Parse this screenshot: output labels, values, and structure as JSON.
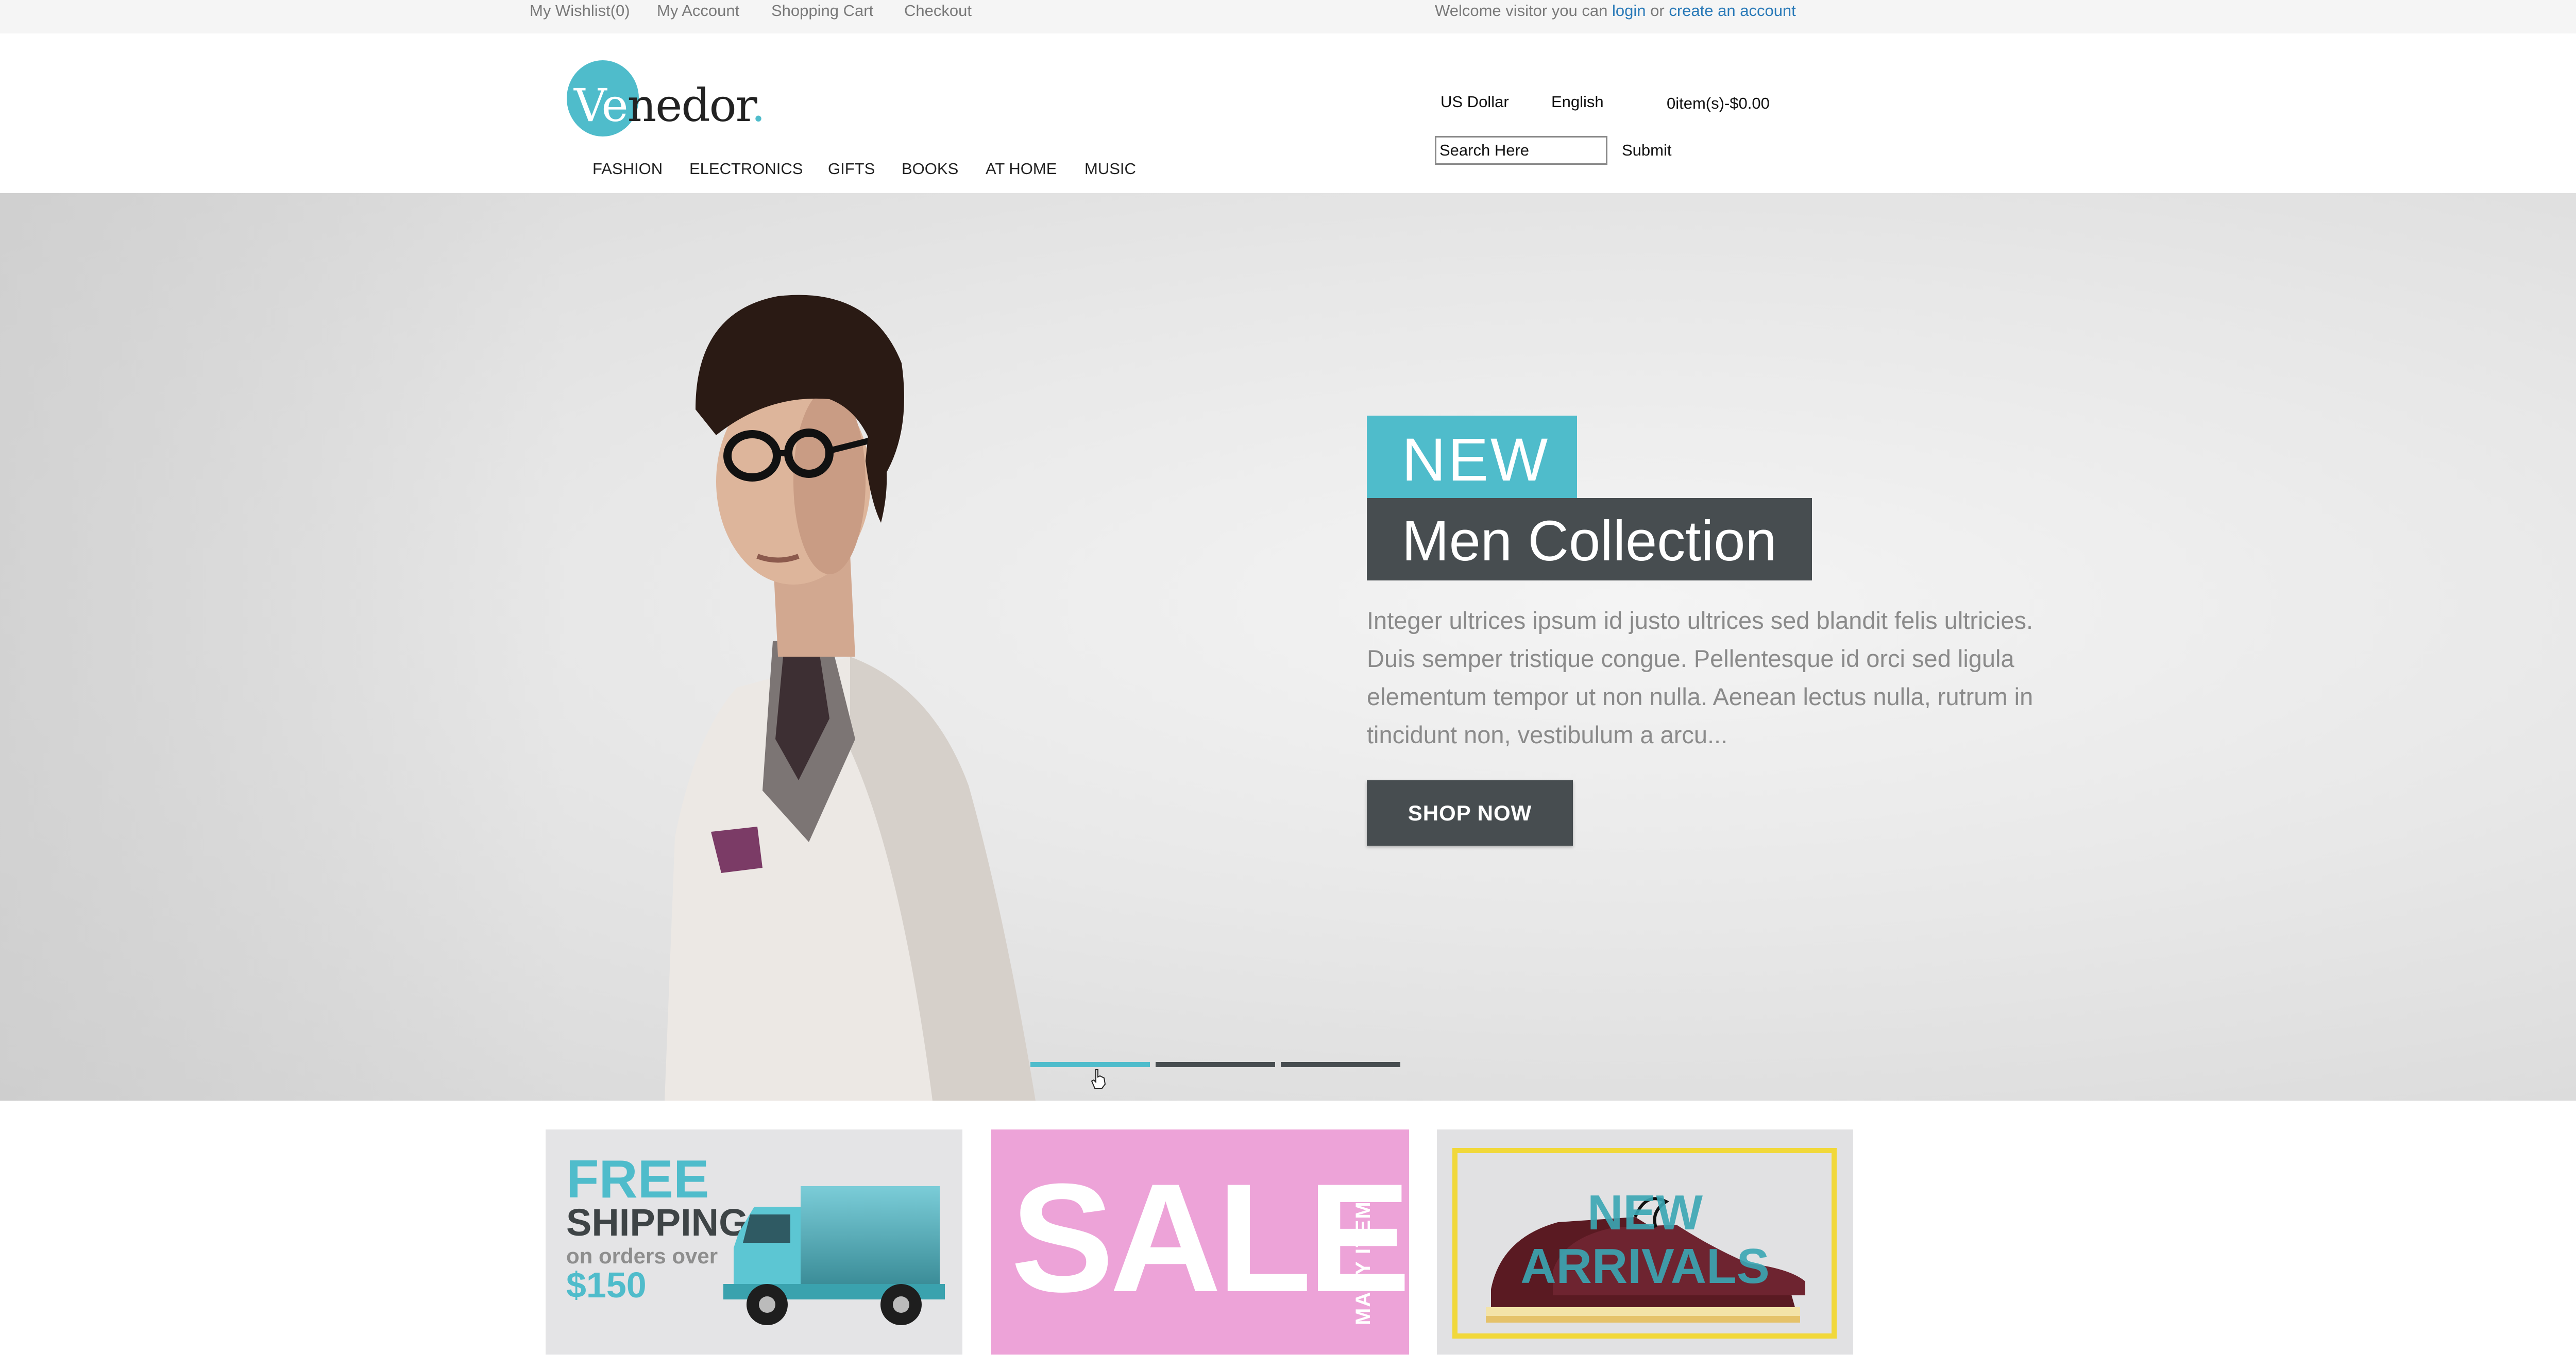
{
  "topbar": {
    "links": {
      "wishlist": "My Wishlist(0)",
      "account": "My Account",
      "cart": "Shopping Cart",
      "checkout": "Checkout"
    },
    "welcome": {
      "prefix": "Welcome visitor you can",
      "login": "login",
      "middle": "or",
      "create": "create an account"
    }
  },
  "header": {
    "logo": {
      "ve": "Ve",
      "rest": "nedor",
      "dot": "."
    },
    "nav": [
      "FASHION",
      "ELECTRONICS",
      "GIFTS",
      "BOOKS",
      "AT HOME",
      "MUSIC"
    ],
    "currency": "US Dollar",
    "language": "English",
    "cart_summary": "0item(s)-$0.00",
    "search": {
      "value": "Search Here",
      "submit_label": "Submit"
    }
  },
  "hero": {
    "badge": "NEW",
    "title": "Men Collection",
    "description": "Integer ultrices ipsum id justo ultrices sed blandit felis ultricies. Duis semper tristique congue. Pellentesque id orci sed ligula elementum tempor ut non nulla. Aenean lectus nulla, rutrum in tincidunt non, vestibulum a arcu...",
    "button": "SHOP NOW",
    "slides_total": 3,
    "active_slide": 1
  },
  "promos": {
    "shipping": {
      "line1": "FREE",
      "line2": "SHIPPING",
      "line3": "on orders over",
      "line4": "$150"
    },
    "sale": {
      "main": "SALE",
      "side": "MANY ITEMS"
    },
    "arrivals": {
      "line1": "NEW",
      "line2": "ARRIVALS"
    }
  },
  "colors": {
    "accent": "#4fbccb",
    "dark": "#474d50",
    "sale_pink": "#eda3d8",
    "frame_yellow": "#f1d83a",
    "link_blue": "#2a7ab8"
  },
  "icons": [
    "hand-cursor-icon",
    "truck-icon"
  ]
}
